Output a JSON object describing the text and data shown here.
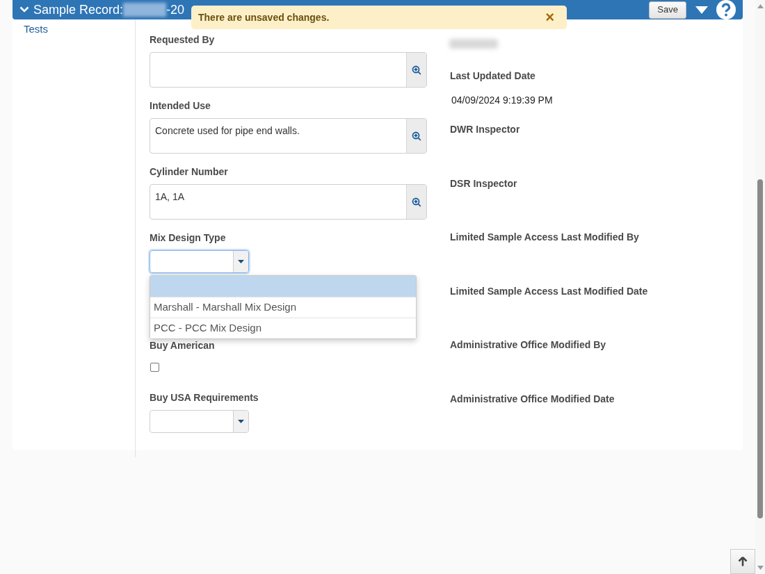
{
  "header": {
    "title": "Sample Record:",
    "title_suffix": "-20",
    "expanded": true,
    "save_label": "Save"
  },
  "toast": {
    "message": "There are unsaved changes.",
    "close": "×"
  },
  "sidebar": {
    "items": [
      {
        "label": "Tests"
      }
    ]
  },
  "left_fields": [
    {
      "kind": "lookup",
      "label": "Requested By"
    },
    {
      "kind": "lookup",
      "label": "Intended Use",
      "value": "Concrete used for pipe end walls."
    },
    {
      "kind": "lookup",
      "label": "Cylinder Number",
      "value": "1A, 1A"
    },
    {
      "kind": "select",
      "label": "Mix Design Type",
      "focused": true,
      "open": true,
      "options": [
        {
          "selected": true
        },
        {
          "label": "Marshall - Marshall Mix Design",
          "selected": false
        },
        {
          "label": "PCC - PCC Mix Design",
          "selected": false
        }
      ]
    },
    {
      "kind": "checkbox",
      "label": "Buy American",
      "checked": false
    },
    {
      "kind": "select",
      "label": "Buy USA Requirements",
      "focused": false,
      "open": false
    }
  ],
  "right_fields": [
    {
      "redacted": true
    },
    {
      "label": "Last Updated Date",
      "value": "04/09/2024 9:19:39 PM"
    },
    {
      "label": "DWR Inspector"
    },
    {
      "label": "DSR Inspector"
    },
    {
      "label": "Limited Sample Access Last Modified By"
    },
    {
      "label": "Limited Sample Access Last Modified Date"
    },
    {
      "label": "Administrative Office Modified By"
    },
    {
      "label": "Administrative Office Modified Date"
    }
  ]
}
